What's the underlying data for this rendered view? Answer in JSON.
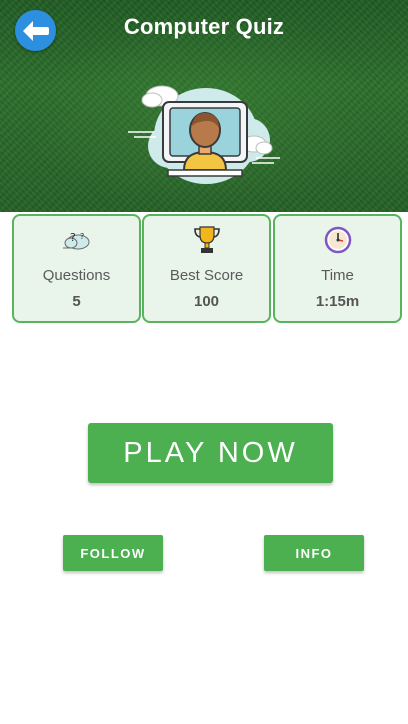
{
  "app": {
    "title": "Computer Quiz"
  },
  "header": {
    "back_icon": "back-arrow-icon",
    "illustration": "person-at-monitor-with-clouds"
  },
  "stats": [
    {
      "icon": "question-cloud-icon",
      "label": "Questions",
      "value": "5"
    },
    {
      "icon": "trophy-icon",
      "label": "Best Score",
      "value": "100"
    },
    {
      "icon": "clock-icon",
      "label": "Time",
      "value": "1:15m"
    }
  ],
  "actions": {
    "play_label": "PLAY NOW",
    "follow_label": "FOLLOW",
    "info_label": "INFO"
  },
  "colors": {
    "accent_green": "#4caf50",
    "card_border": "#59b35c",
    "card_bg": "#e9f4ea",
    "back_button_blue": "#2d8fe0"
  }
}
